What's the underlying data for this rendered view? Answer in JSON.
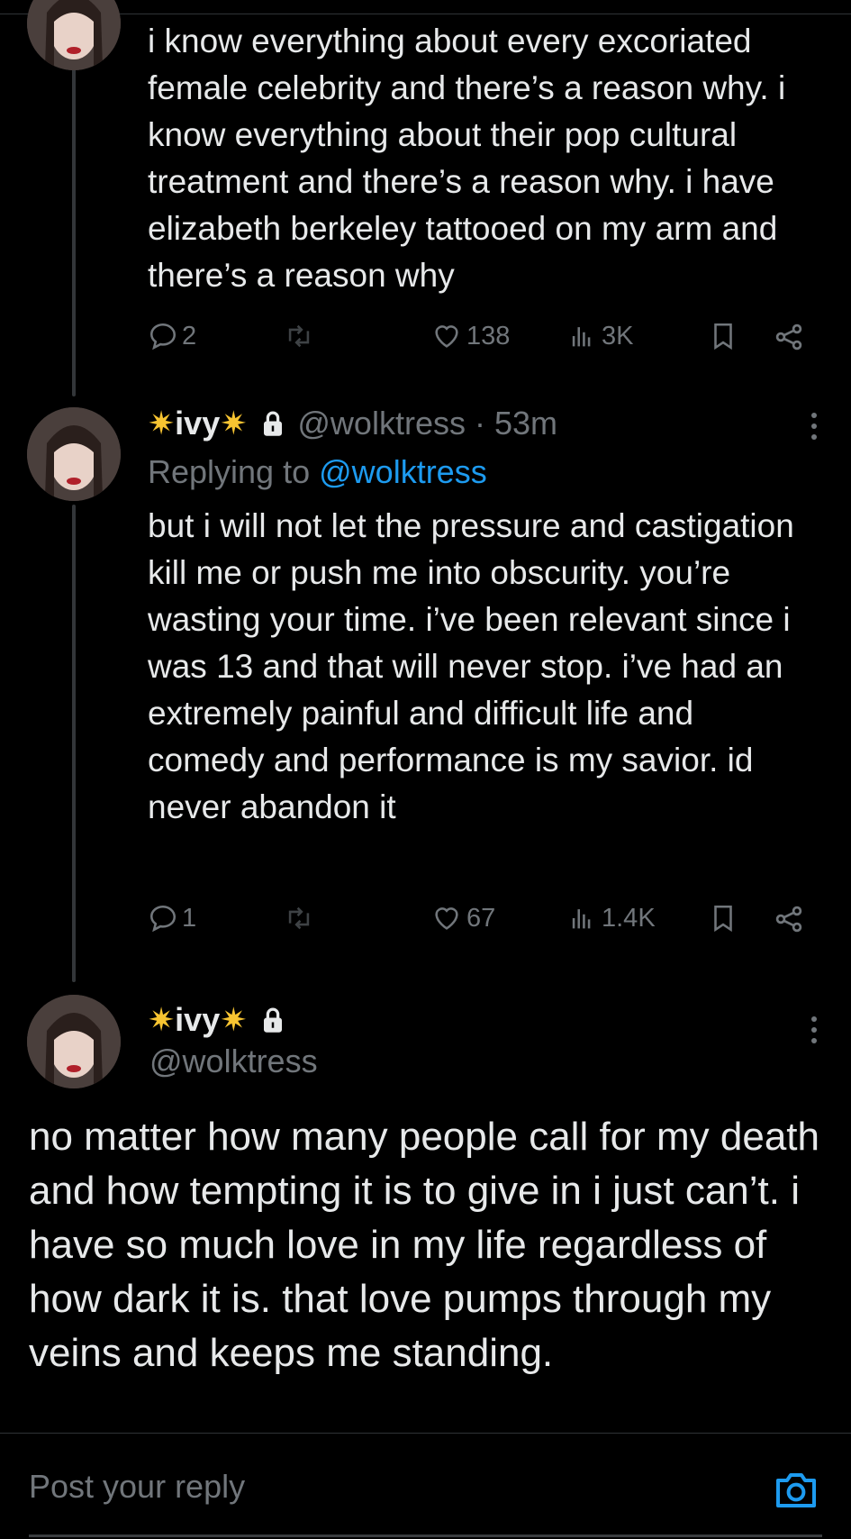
{
  "tweets": [
    {
      "text": "i know everything about every excoriated female celebrity and there’s a reason why. i know everything about their pop cultural treatment and there’s a reason why. i have elizabeth berkeley tattooed on my arm and there’s a reason why",
      "replies": "2",
      "likes": "138",
      "views": "3K"
    },
    {
      "name": "ivy",
      "handle_time": "@wolktress · 53m",
      "replying_prefix": "Replying to",
      "replying_to": "@wolktress",
      "text": "but i will not let the pressure and castigation kill me or push me into obscurity. you’re wasting your time. i’ve been relevant since i was 13 and that will never stop. i’ve had an extremely painful and difficult life and comedy and performance is my savior. id never abandon it",
      "replies": "1",
      "likes": "67",
      "views": "1.4K"
    }
  ],
  "main_tweet": {
    "name": "ivy",
    "handle": "@wolktress",
    "text": "no matter how many people call for my death and how tempting it is to give in i just can’t. i have so much love in my life regardless of how dark it is. that love pumps through my veins and keeps me standing."
  },
  "name_decoration": "✷",
  "compose": {
    "placeholder": "Post your reply"
  },
  "colors": {
    "background": "#000000",
    "text": "#e7e9ea",
    "muted": "#71767b",
    "link": "#1d9bf0",
    "star": "#f7c431"
  },
  "icons": [
    "reply-icon",
    "repost-icon",
    "like-icon",
    "views-icon",
    "bookmark-icon",
    "share-icon",
    "lock-icon",
    "more-icon",
    "camera-icon"
  ]
}
